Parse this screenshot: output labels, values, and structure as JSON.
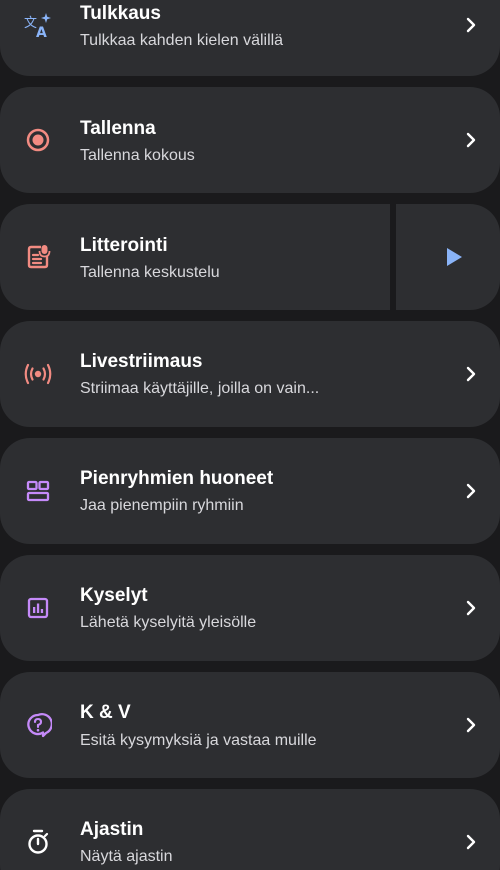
{
  "colors": {
    "background": "#1a1a1c",
    "card": "#2d2e31",
    "accent_blue": "#8ab4f8",
    "accent_red": "#f28b82",
    "accent_purple": "#c58af9"
  },
  "items": [
    {
      "title": "Tulkkaus",
      "subtitle": "Tulkkaa kahden kielen välillä",
      "icon": "translate-icon"
    },
    {
      "title": "Tallenna",
      "subtitle": "Tallenna kokous",
      "icon": "record-icon"
    },
    {
      "title": "Litterointi",
      "subtitle": "Tallenna keskustelu",
      "icon": "transcript-icon",
      "action_icon": "play-icon"
    },
    {
      "title": "Livestriimaus",
      "subtitle": "Striimaa käyttäjille, joilla on vain...",
      "icon": "live-stream-icon"
    },
    {
      "title": "Pienryhmien huoneet",
      "subtitle": "Jaa pienempiin ryhmiin",
      "icon": "breakout-rooms-icon"
    },
    {
      "title": "Kyselyt",
      "subtitle": "Lähetä kyselyitä yleisölle",
      "icon": "poll-icon"
    },
    {
      "title": "K & V",
      "subtitle": "Esitä kysymyksiä ja vastaa muille",
      "icon": "qa-icon"
    },
    {
      "title": "Ajastin",
      "subtitle": "Näytä ajastin",
      "icon": "timer-icon"
    }
  ]
}
